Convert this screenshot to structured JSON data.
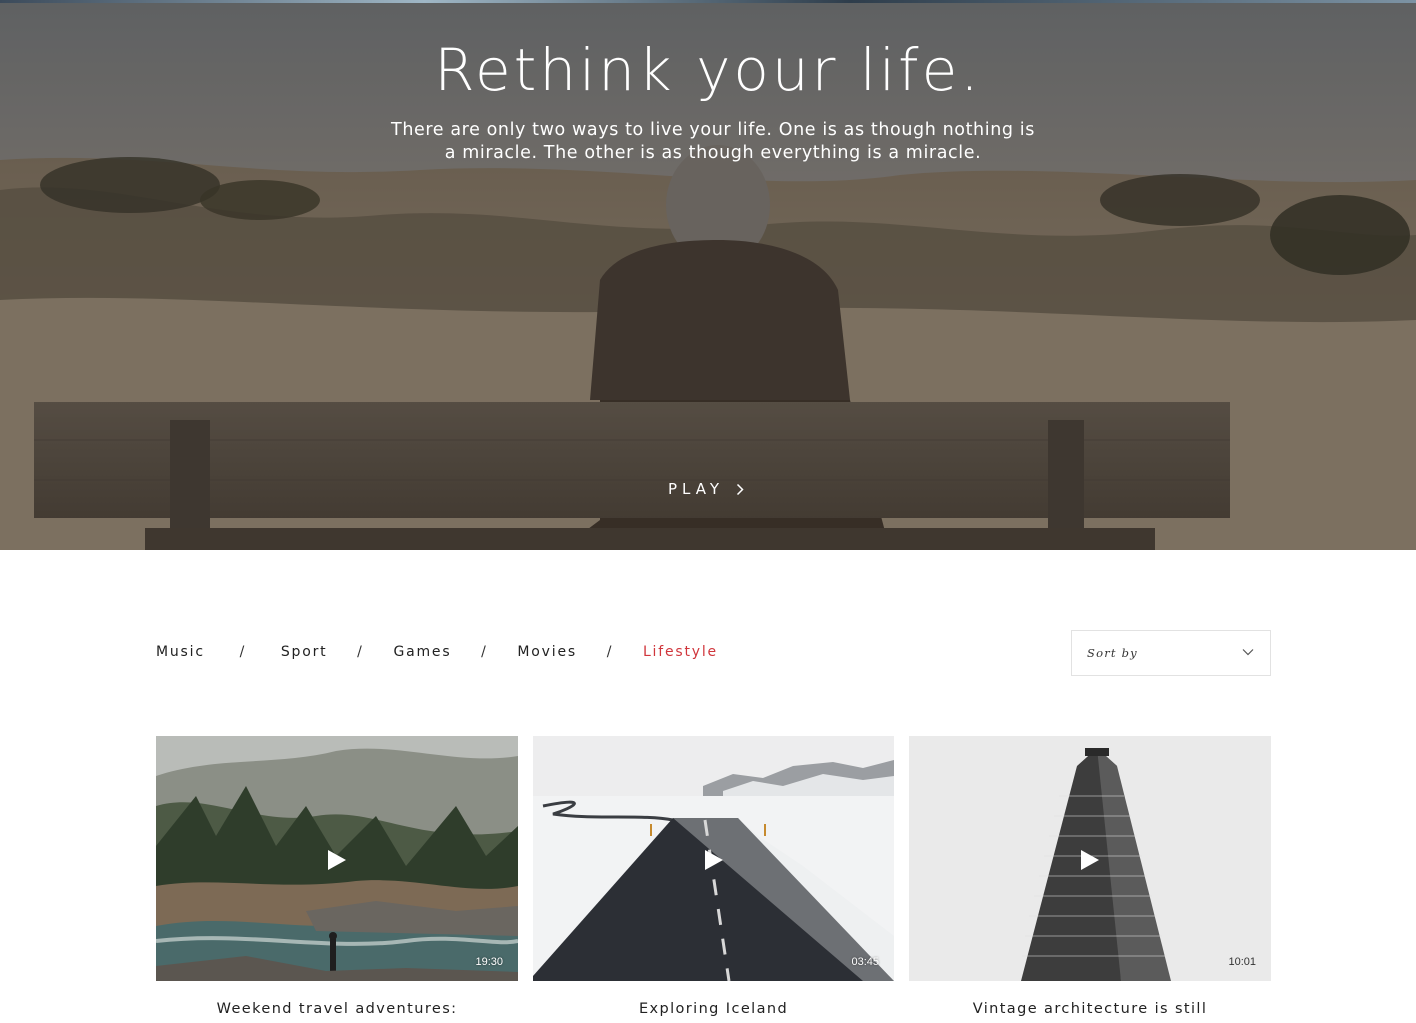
{
  "hero": {
    "title": "Rethink your life.",
    "subtitle": "There are only two ways to live your life. One is as though nothing is a miracle. The other is as though everything is a miracle.",
    "play_label": "PLAY",
    "play_icon": "chevron-right-icon"
  },
  "filters": {
    "items": [
      {
        "label": "Music",
        "active": false
      },
      {
        "label": "Sport",
        "active": false
      },
      {
        "label": "Games",
        "active": false
      },
      {
        "label": "Movies",
        "active": false
      },
      {
        "label": "Lifestyle",
        "active": true
      }
    ],
    "separator": "/",
    "active_color": "#d0363c"
  },
  "sort": {
    "label": "Sort by",
    "icon": "chevron-down-icon"
  },
  "videos": [
    {
      "title": "Weekend travel adventures:",
      "duration": "19:30",
      "icon": "play-icon"
    },
    {
      "title": "Exploring Iceland",
      "duration": "03:45",
      "icon": "play-icon"
    },
    {
      "title": "Vintage architecture is still",
      "duration": "10:01",
      "icon": "play-icon"
    }
  ]
}
